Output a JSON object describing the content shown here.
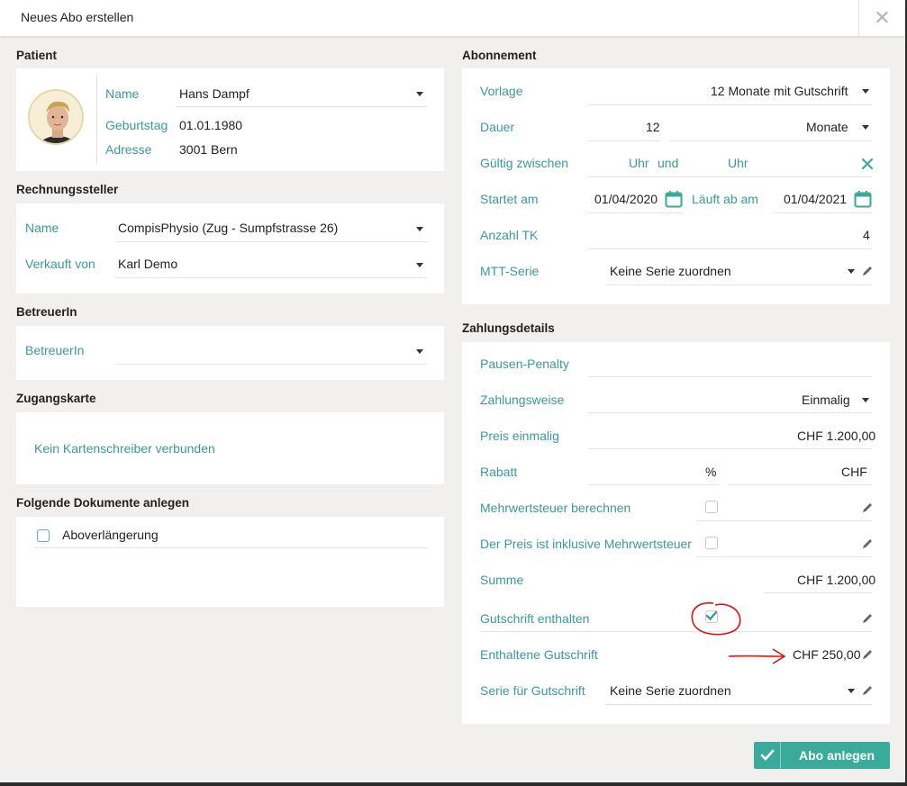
{
  "dialog": {
    "title": "Neues Abo erstellen",
    "close_icon": "close-icon"
  },
  "patient": {
    "section_title": "Patient",
    "name_label": "Name",
    "name_value": "Hans Dampf",
    "birthday_label": "Geburtstag",
    "birthday_value": "01.01.1980",
    "address_label": "Adresse",
    "address_value": "3001 Bern"
  },
  "billing": {
    "section_title": "Rechnungssteller",
    "name_label": "Name",
    "name_value": "CompisPhysio (Zug - Sumpfstrasse 26)",
    "sold_by_label": "Verkauft von",
    "sold_by_value": "Karl Demo"
  },
  "caregiver": {
    "section_title": "BetreuerIn",
    "label": "BetreuerIn",
    "value": ""
  },
  "access_card": {
    "section_title": "Zugangskarte",
    "message": "Kein Kartenschreiber verbunden"
  },
  "documents": {
    "section_title": "Folgende Dokumente anlegen",
    "items": [
      {
        "label": "Aboverlängerung",
        "checked": false
      }
    ]
  },
  "subscription": {
    "section_title": "Abonnement",
    "template_label": "Vorlage",
    "template_value": "12 Monate mit Gutschrift",
    "duration_label": "Dauer",
    "duration_value": "12",
    "duration_unit": "Monate",
    "valid_label": "Gültig zwischen",
    "valid_from_unit": "Uhr",
    "valid_and": "und",
    "valid_to_unit": "Uhr",
    "start_label": "Startet am",
    "start_value": "01/04/2020",
    "end_label": "Läuft ab am",
    "end_value": "01/04/2021",
    "count_label": "Anzahl TK",
    "count_value": "4",
    "mtt_label": "MTT-Serie",
    "mtt_value": "Keine Serie zuordnen"
  },
  "payment": {
    "section_title": "Zahlungsdetails",
    "pause_label": "Pausen-Penalty",
    "method_label": "Zahlungsweise",
    "method_value": "Einmalig",
    "price_label": "Preis einmalig",
    "price_value": "CHF 1.200,00",
    "discount_label": "Rabatt",
    "discount_pct_unit": "%",
    "discount_chf_unit": "CHF",
    "vat_calc_label": "Mehrwertsteuer berechnen",
    "vat_calc_checked": false,
    "vat_incl_label": "Der Preis ist inklusive Mehrwertsteuer",
    "vat_incl_checked": false,
    "sum_label": "Summe",
    "sum_value": "CHF 1.200,00",
    "credit_incl_label": "Gutschrift enthalten",
    "credit_incl_checked": true,
    "credit_amount_label": "Enthaltene Gutschrift",
    "credit_amount_value": "CHF 250,00",
    "credit_series_label": "Serie für Gutschrift",
    "credit_series_value": "Keine Serie zuordnen"
  },
  "footer": {
    "create_label": "Abo anlegen"
  },
  "colors": {
    "accent": "#3a9a97",
    "button": "#3aaa9a",
    "annotation": "#e01010"
  }
}
